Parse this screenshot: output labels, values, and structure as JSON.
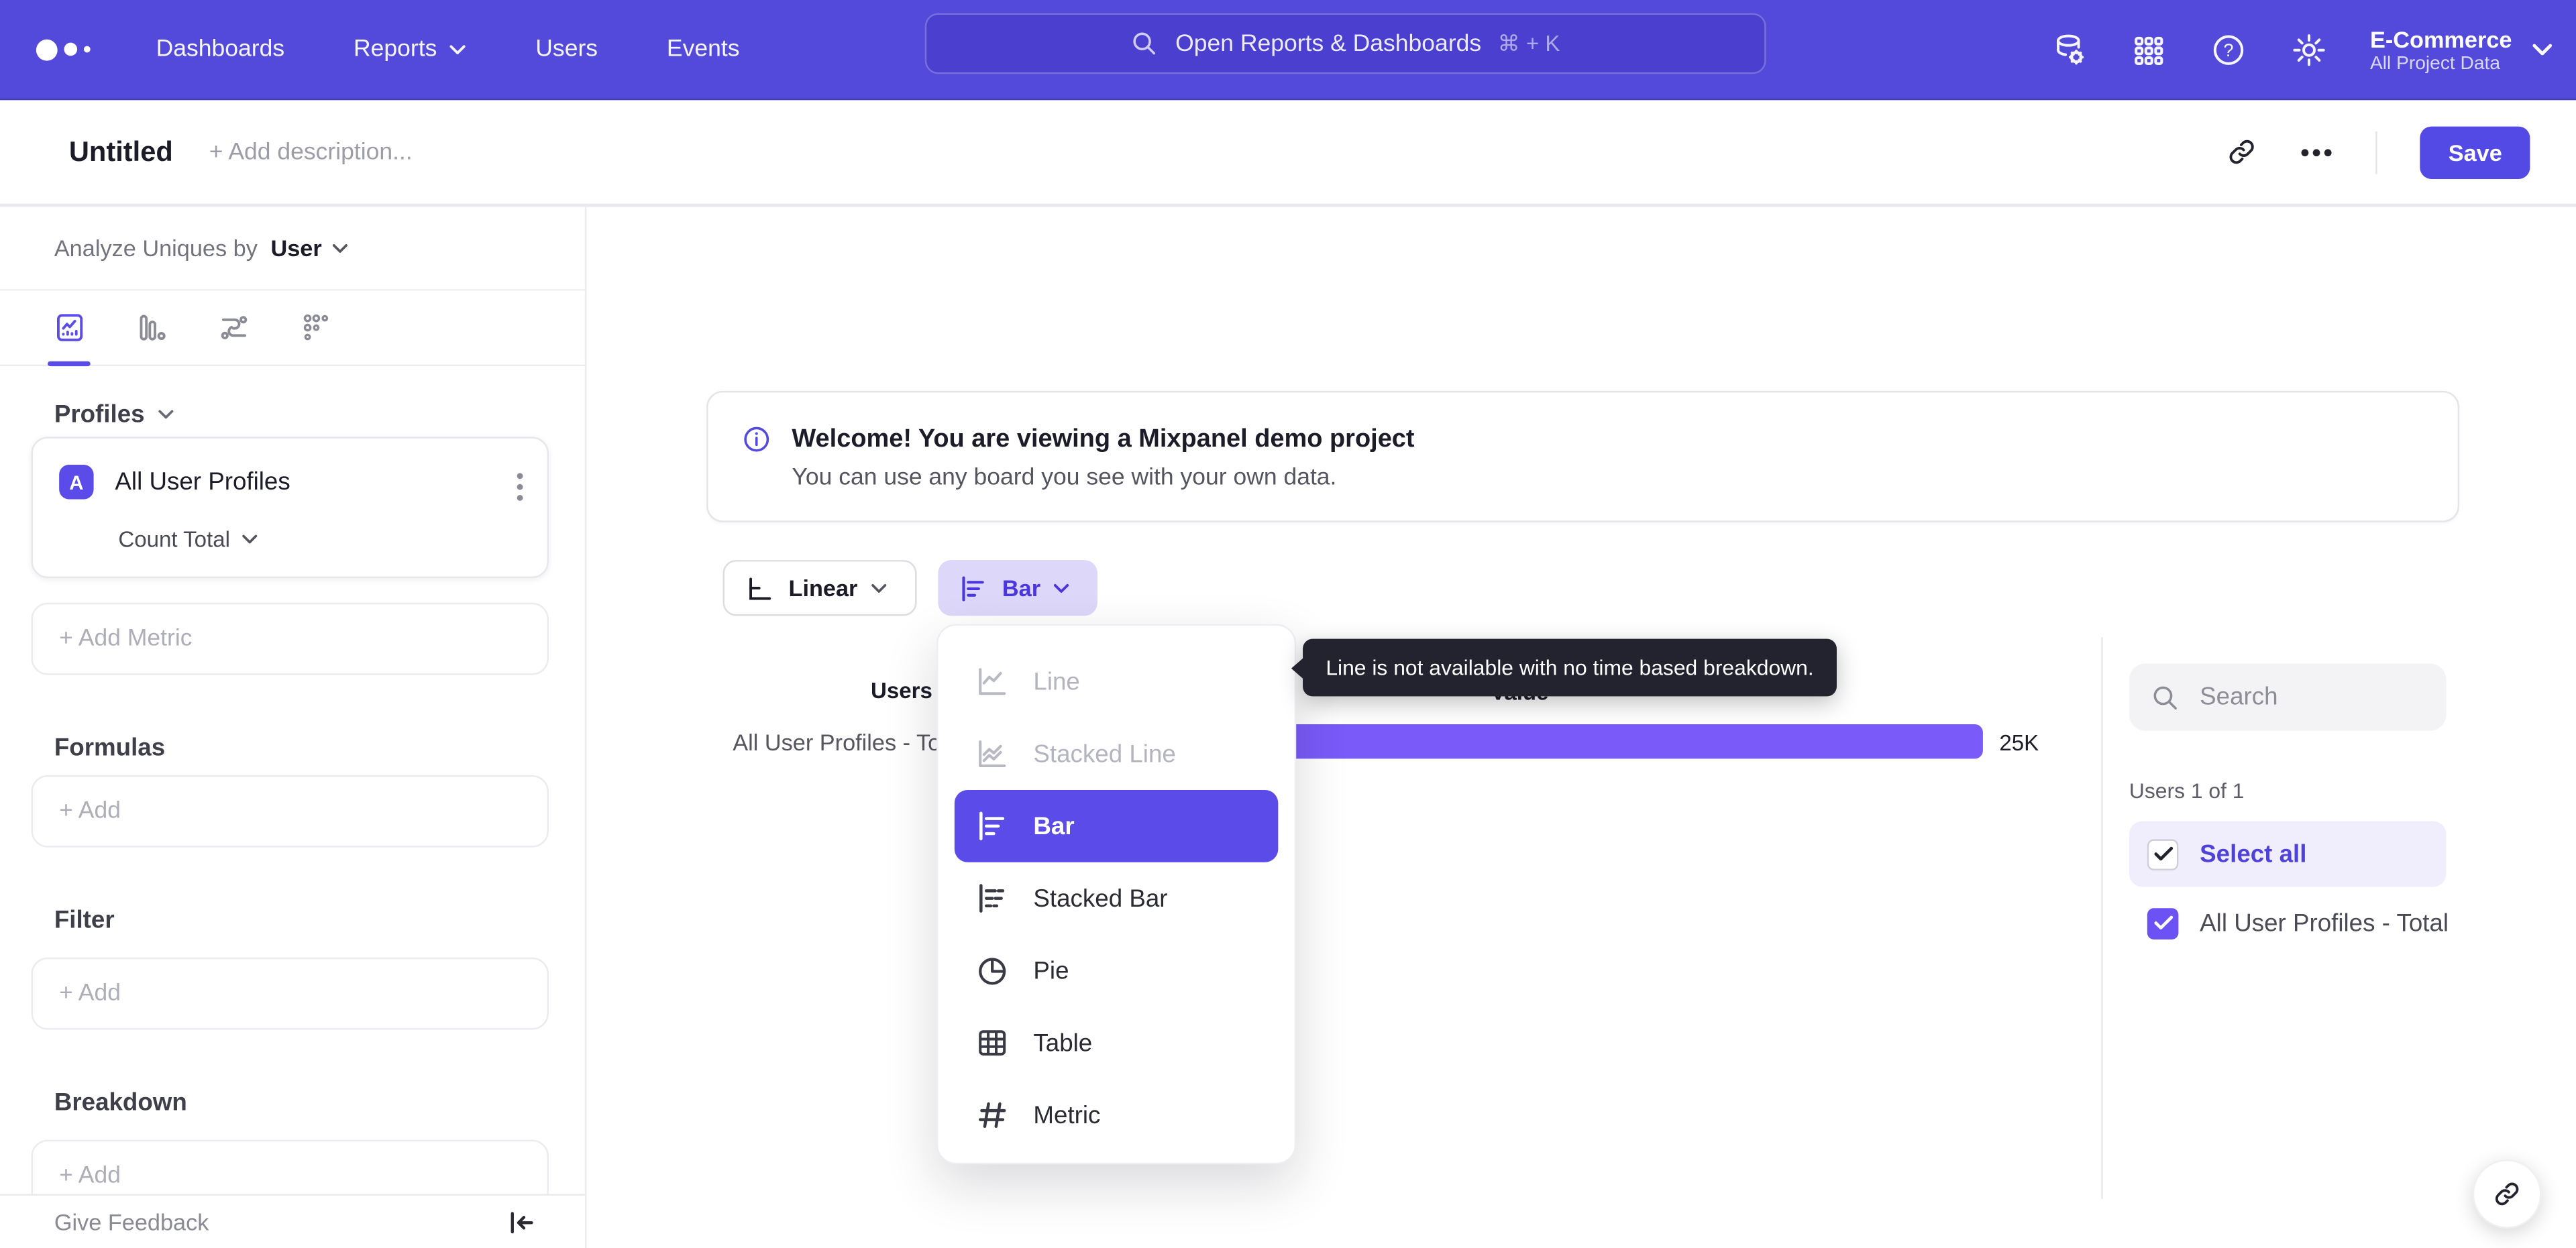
{
  "nav": {
    "items": [
      "Dashboards",
      "Reports",
      "Users",
      "Events"
    ],
    "search": {
      "placeholder": "Open Reports & Dashboards",
      "shortcut": "⌘ + K"
    },
    "project": {
      "name": "E-Commerce",
      "scope": "All Project Data"
    }
  },
  "toolbar": {
    "title": "Untitled",
    "description_placeholder": "+ Add description...",
    "save_label": "Save"
  },
  "sidebar": {
    "analyze_prefix": "Analyze Uniques by",
    "analyze_value": "User",
    "profiles_label": "Profiles",
    "metric_card": {
      "badge": "A",
      "name": "All User Profiles",
      "aggregation": "Count Total"
    },
    "add_metric_label": "+ Add Metric",
    "formulas_label": "Formulas",
    "filter_label": "Filter",
    "breakdown_label": "Breakdown",
    "add_label": "+ Add",
    "give_feedback_label": "Give Feedback"
  },
  "banner": {
    "title": "Welcome! You are viewing a Mixpanel demo project",
    "subtitle": "You can use any board you see with your own data."
  },
  "controls": {
    "scale_label": "Linear",
    "chart_type_label": "Bar"
  },
  "chart_menu": {
    "items": [
      {
        "label": "Line",
        "state": "disabled"
      },
      {
        "label": "Stacked Line",
        "state": "disabled"
      },
      {
        "label": "Bar",
        "state": "selected"
      },
      {
        "label": "Stacked Bar",
        "state": "normal"
      },
      {
        "label": "Pie",
        "state": "normal"
      },
      {
        "label": "Table",
        "state": "normal"
      },
      {
        "label": "Metric",
        "state": "normal"
      }
    ]
  },
  "tooltip": {
    "text": "Line is not available with no time based breakdown."
  },
  "chart": {
    "columns": {
      "users": "Users",
      "value": "Value"
    },
    "row_label": "All User Profiles - Total",
    "value_text": "25K"
  },
  "chart_data": {
    "type": "bar",
    "orientation": "horizontal",
    "series_name": "Users",
    "categories": [
      "All User Profiles - Total"
    ],
    "values": [
      25000
    ],
    "value_labels": [
      "25K"
    ]
  },
  "right_panel": {
    "search_placeholder": "Search",
    "count_label": "Users 1 of 1",
    "select_all_label": "Select all",
    "item_label": "All User Profiles - Total"
  },
  "icons": {
    "help_glyph": "?",
    "metric_hash": "#"
  },
  "colors": {
    "nav": "#5349db",
    "accent": "#5b4be8",
    "bar": "#7a5af8",
    "bar_button_bg": "#ddd7f9",
    "tooltip_bg": "#23232f",
    "select_all_bg": "#f0eefc"
  }
}
